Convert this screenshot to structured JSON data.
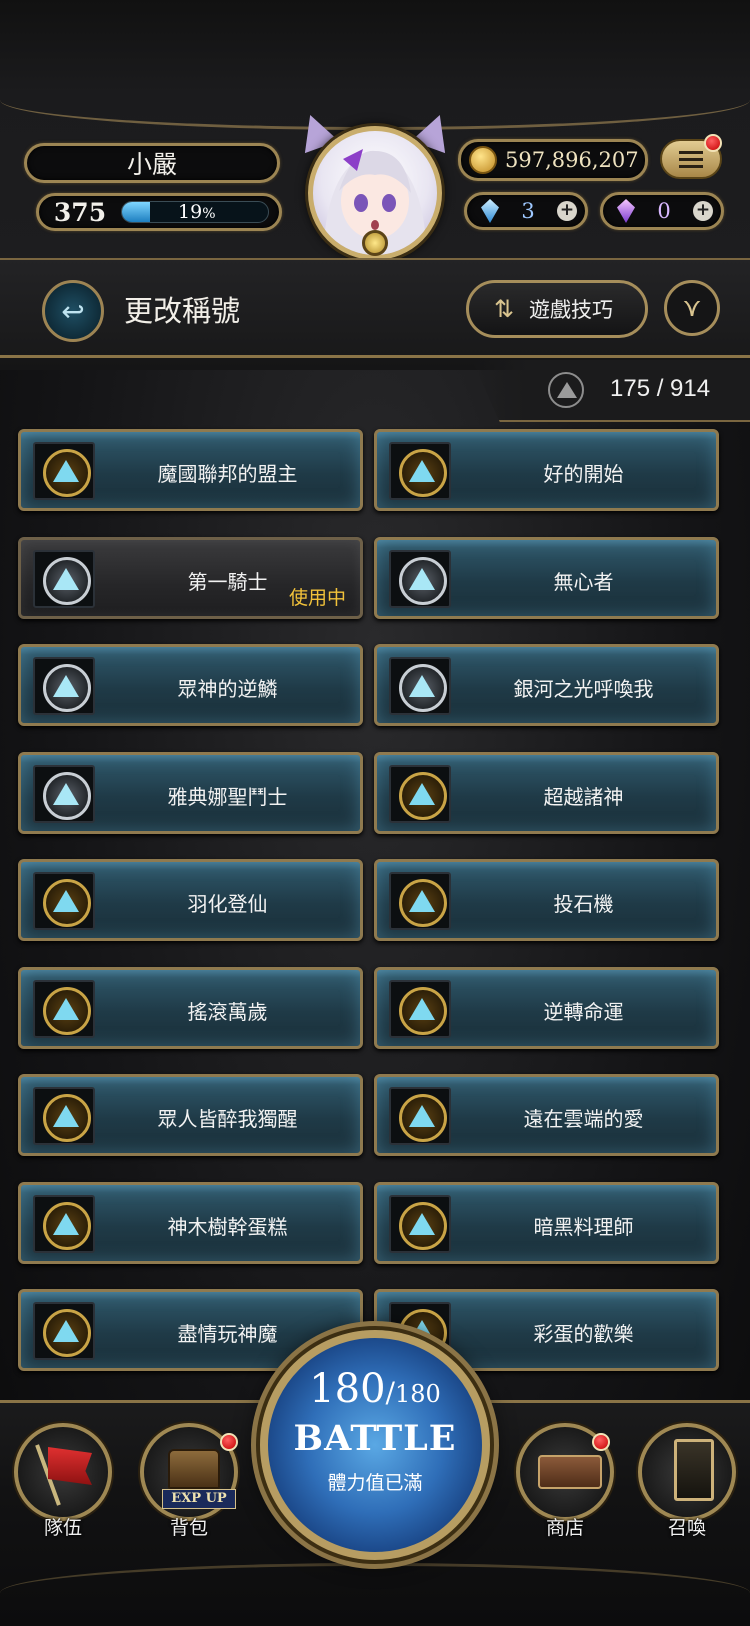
{
  "player": {
    "name": "小嚴",
    "level": "375",
    "xp_percent": "19",
    "xp_unit": "%",
    "xp_fraction": 0.19
  },
  "currency": {
    "coins": "597,896,207",
    "gems": "3",
    "crystals": "0",
    "plus": "+"
  },
  "header": {
    "title": "更改稱號",
    "tips_label": "遊戲技巧",
    "title_count": "175 / 914"
  },
  "titles": [
    {
      "label": "魔國聯邦的盟主",
      "badge": "gold"
    },
    {
      "label": "好的開始",
      "badge": "gold"
    },
    {
      "label": "第一騎士",
      "badge": "silver",
      "status": "使用中"
    },
    {
      "label": "無心者",
      "badge": "silver"
    },
    {
      "label": "眾神的逆鱗",
      "badge": "silver"
    },
    {
      "label": "銀河之光呼喚我",
      "badge": "silver"
    },
    {
      "label": "雅典娜聖鬥士",
      "badge": "silver"
    },
    {
      "label": "超越諸神",
      "badge": "gold"
    },
    {
      "label": "羽化登仙",
      "badge": "gold"
    },
    {
      "label": "投石機",
      "badge": "gold"
    },
    {
      "label": "搖滾萬歲",
      "badge": "gold"
    },
    {
      "label": "逆轉命運",
      "badge": "gold"
    },
    {
      "label": "眾人皆醉我獨醒",
      "badge": "gold"
    },
    {
      "label": "遠在雲端的愛",
      "badge": "gold"
    },
    {
      "label": "神木樹幹蛋糕",
      "badge": "gold"
    },
    {
      "label": "暗黑料理師",
      "badge": "gold"
    },
    {
      "label": "盡情玩神魔",
      "badge": "gold"
    },
    {
      "label": "彩蛋的歡樂",
      "badge": "gold"
    }
  ],
  "nav": {
    "team": "隊伍",
    "backpack": "背包",
    "backpack_tag": "EXP UP",
    "shop": "商店",
    "summon": "召喚"
  },
  "battle": {
    "stamina_current": "180",
    "stamina_separator": "/",
    "stamina_max": "180",
    "label": "BATTLE",
    "status": "體力值已滿"
  },
  "icons": {
    "back": "back-arrow-icon",
    "tips": "swap-arrows-icon",
    "filter": "filter-icon",
    "menu": "hamburger-menu-icon"
  },
  "colors": {
    "accent_gold": "#a88d58",
    "active_status": "#f2c23a",
    "notification": "#c40000"
  }
}
